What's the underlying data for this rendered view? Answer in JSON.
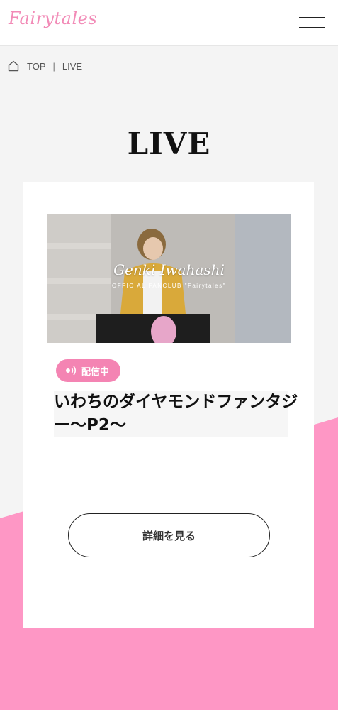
{
  "header": {
    "logo_text": "Fairytales",
    "menu_icon": "hamburger-menu-icon"
  },
  "breadcrumb": {
    "home_icon": "home-icon",
    "items": [
      "TOP",
      "LIVE"
    ],
    "separator": "|"
  },
  "page": {
    "title": "LIVE"
  },
  "live_card": {
    "banner": {
      "name": "Genki Iwahashi",
      "subtitle": "OFFICIAL FANCLUB \"Fairytales\""
    },
    "badge": {
      "icon": "broadcast-icon",
      "label": "配信中"
    },
    "title": "いわちのダイヤモンドファンタジー〜P2〜",
    "detail_button": "詳細を見る"
  },
  "colors": {
    "accent_pink": "#f484b3",
    "background_pink": "#fe97c5",
    "logo_pink": "#f28bb7",
    "page_bg": "#f4f4f4"
  }
}
